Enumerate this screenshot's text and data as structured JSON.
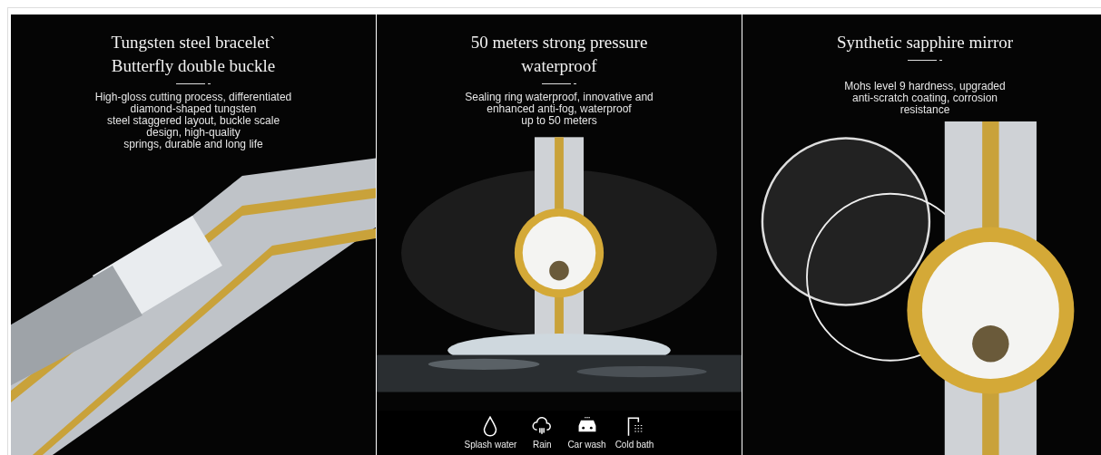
{
  "panels": [
    {
      "kind": "bracelet",
      "title_lines": [
        "Tungsten steel bracelet`",
        "Butterfly double buckle"
      ],
      "description_lines": [
        "High-gloss cutting process, differentiated",
        "diamond-shaped tungsten",
        "steel staggered layout, buckle scale",
        "design, high-quality",
        "springs, durable and long life"
      ],
      "picture": {
        "kind": "picture"
      }
    },
    {
      "kind": "splash",
      "title_lines": [
        "50 meters strong pressure",
        "waterproof"
      ],
      "description_lines": [
        "Sealing ring waterproof, innovative and",
        "enhanced anti-fog, waterproof",
        "up to 50 meters"
      ],
      "picture": {
        "kind": "picture"
      },
      "features": [
        {
          "kind": "drop",
          "label": "Splash water"
        },
        {
          "kind": "rain",
          "label": "Rain"
        },
        {
          "kind": "car",
          "label": "Car wash"
        },
        {
          "kind": "shower",
          "label": "Cold bath"
        }
      ]
    },
    {
      "kind": "crystal",
      "title_lines": [
        "Synthetic sapphire mirror"
      ],
      "description_lines": [
        "Mohs level 9 hardness, upgraded",
        "anti-scratch coating, corrosion",
        "resistance"
      ],
      "picture": {
        "kind": "picture"
      }
    }
  ]
}
